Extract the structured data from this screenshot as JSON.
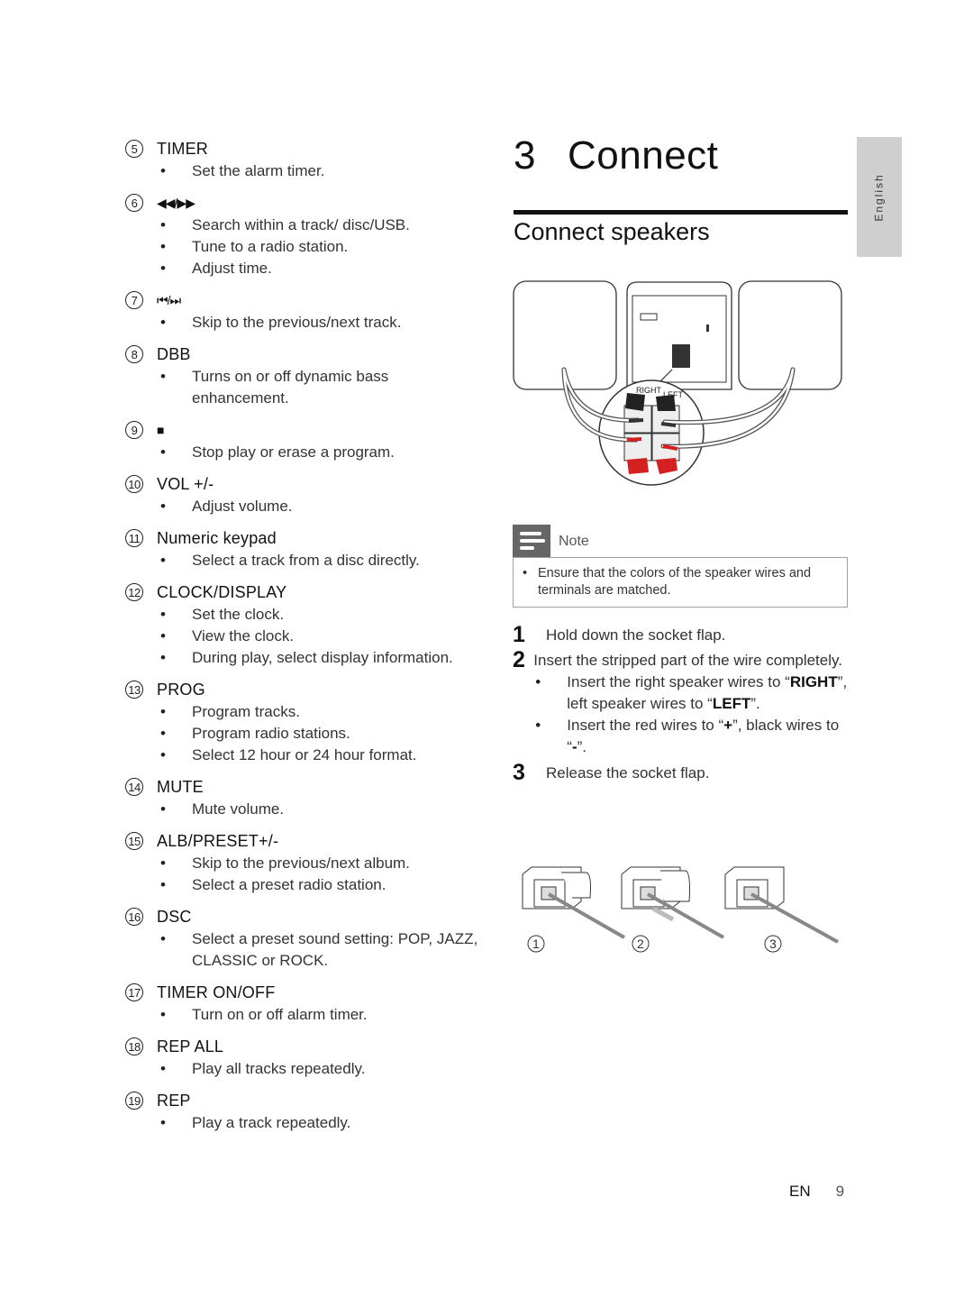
{
  "controls": [
    {
      "num": "5",
      "title": "TIMER",
      "bullets": [
        "Set the alarm timer."
      ]
    },
    {
      "num": "6",
      "title": "◀◀/▶▶",
      "glyph": true,
      "bullets": [
        "Search within a track/ disc/USB.",
        "Tune to a radio station.",
        "Adjust time."
      ]
    },
    {
      "num": "7",
      "title": "⏮/⏭",
      "glyph": true,
      "bullets": [
        "Skip to the previous/next track."
      ]
    },
    {
      "num": "8",
      "title": "DBB",
      "bullets": [
        "Turns on or off dynamic bass enhancement."
      ]
    },
    {
      "num": "9",
      "title": "■",
      "glyph": true,
      "bullets": [
        "Stop play or erase a program."
      ]
    },
    {
      "num": "10",
      "title": "VOL +/-",
      "bullets": [
        "Adjust volume."
      ]
    },
    {
      "num": "11",
      "title": "Numeric keypad",
      "bullets": [
        "Select a track from a disc directly."
      ]
    },
    {
      "num": "12",
      "title": "CLOCK/DISPLAY",
      "bullets": [
        "Set the clock.",
        "View the clock.",
        "During play, select display information."
      ]
    },
    {
      "num": "13",
      "title": "PROG",
      "bullets": [
        "Program tracks.",
        "Program radio stations.",
        "Select 12 hour or 24 hour format."
      ]
    },
    {
      "num": "14",
      "title": "MUTE",
      "bullets": [
        "Mute volume."
      ]
    },
    {
      "num": "15",
      "title": "ALB/PRESET+/-",
      "bullets": [
        "Skip to the previous/next album.",
        "Select a preset radio station."
      ]
    },
    {
      "num": "16",
      "title": "DSC",
      "bullets": [
        "Select a preset sound setting: POP, JAZZ, CLASSIC or ROCK."
      ]
    },
    {
      "num": "17",
      "title": "TIMER ON/OFF",
      "bullets": [
        "Turn on or off alarm timer."
      ]
    },
    {
      "num": "18",
      "title": "REP ALL",
      "bullets": [
        "Play all tracks repeatedly."
      ]
    },
    {
      "num": "19",
      "title": "REP",
      "bullets": [
        "Play a track repeatedly."
      ]
    }
  ],
  "chapter": {
    "number": "3",
    "title": "Connect"
  },
  "section_title": "Connect speakers",
  "language_tab": "English",
  "diagram": {
    "label_right": "RIGHT",
    "label_left": "LEFT"
  },
  "note": {
    "label": "Note",
    "text": "Ensure that the colors of the speaker wires and terminals are matched."
  },
  "steps": {
    "s1": {
      "num": "1",
      "text": "Hold down the socket flap."
    },
    "s2": {
      "num": "2",
      "text": "Insert the stripped part of the wire completely.",
      "b1_pre": "Insert the right speaker wires to “",
      "b1_bold1": "RIGHT",
      "b1_mid": "”, left speaker wires to “",
      "b1_bold2": "LEFT",
      "b1_post": "”.",
      "b2_pre": "Insert the red wires to “",
      "b2_bold1": "+",
      "b2_mid": "”, black wires to “",
      "b2_bold2": "-",
      "b2_post": "”."
    },
    "s3": {
      "num": "3",
      "text": "Release the socket flap."
    }
  },
  "flap_labels": [
    "1",
    "2",
    "3"
  ],
  "footer": {
    "lang": "EN",
    "page": "9"
  },
  "colors": {
    "wire_red": "#d42020",
    "tab_gray": "#cfcfcf",
    "note_icon": "#666666"
  }
}
